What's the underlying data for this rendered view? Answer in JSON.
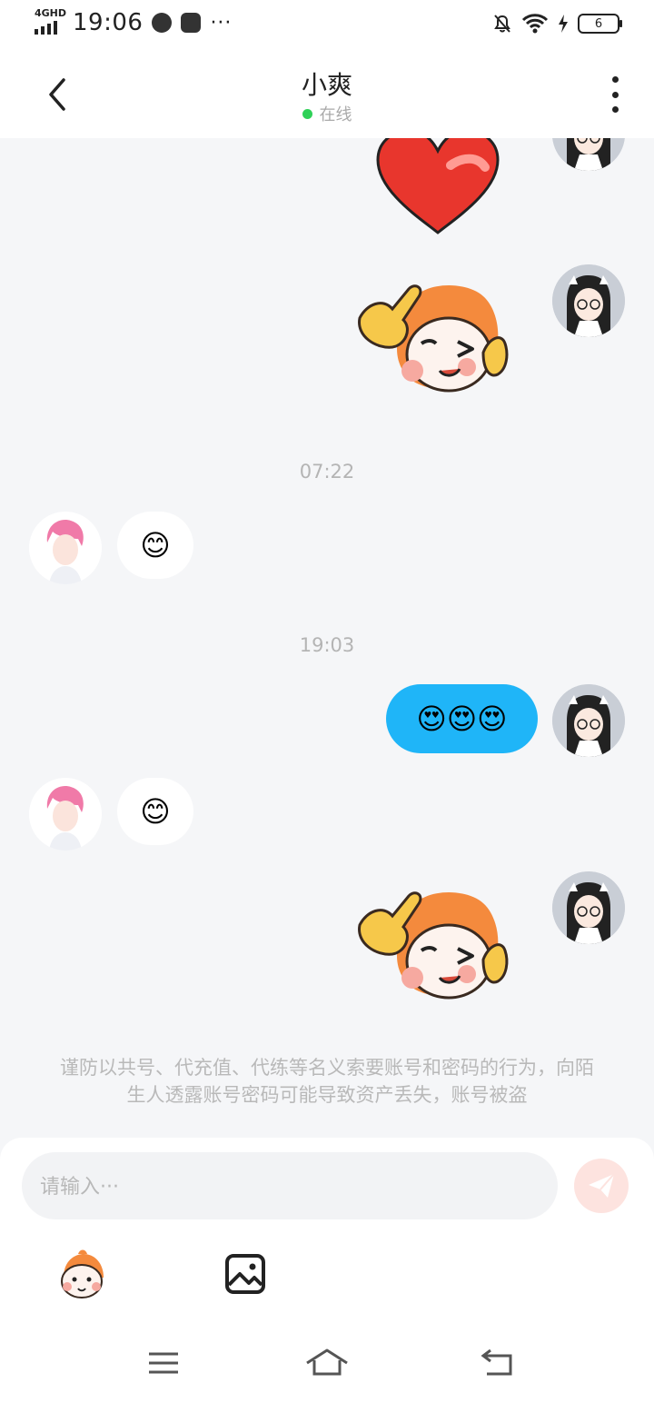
{
  "status_bar": {
    "network": "4GHD",
    "time": "19:06",
    "battery": "6"
  },
  "header": {
    "title": "小爽",
    "status": "在线"
  },
  "messages": {
    "ts1": "07:22",
    "ts2": "19:03",
    "recv1_emoji": "😊",
    "sent_emoji": "😍😍😍",
    "recv2_emoji": "😊"
  },
  "notice": "谨防以共号、代充值、代练等名义索要账号和密码的行为，向陌生人透露账号密码可能导致资产丢失，账号被盗",
  "input": {
    "placeholder": "请输入···"
  },
  "icons": {
    "back": "back-arrow-icon",
    "more": "more-vertical-icon",
    "send": "send-paper-plane-icon",
    "sticker_tool": "mascot-sticker-icon",
    "image_tool": "image-gallery-icon",
    "nav_menu": "menu-icon",
    "nav_home": "home-icon",
    "nav_back": "back-icon"
  },
  "colors": {
    "sent_bubble": "#1fb5f8",
    "online_dot": "#2fd158",
    "send_button": "#fde3df"
  }
}
